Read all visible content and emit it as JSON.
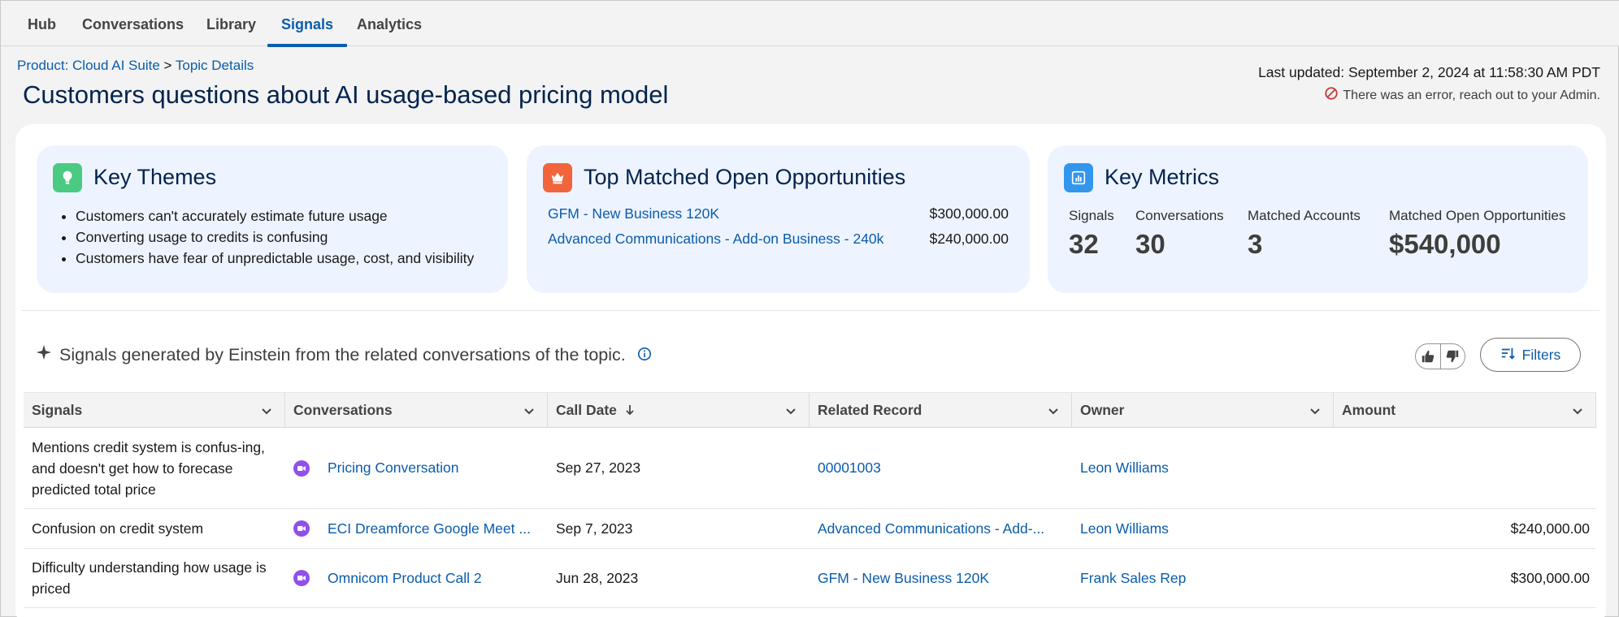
{
  "nav": {
    "tabs": [
      {
        "label": "Hub"
      },
      {
        "label": "Conversations"
      },
      {
        "label": "Library"
      },
      {
        "label": "Signals"
      },
      {
        "label": "Analytics"
      }
    ],
    "active": "Signals"
  },
  "breadcrumb": {
    "product_link": "Product: Cloud AI Suite",
    "separator": ">",
    "current_link": "Topic Details"
  },
  "page": {
    "title": "Customers questions about AI usage-based pricing model",
    "last_updated": "Last updated: September 2, 2024 at 11:58:30 AM PDT",
    "error": "There was an error, reach out to your Admin."
  },
  "colors": {
    "accent": "#0b5cab",
    "themes_icon": "#4bca81",
    "opps_icon": "#f2643b",
    "metrics_icon": "#3296ed",
    "error": "#c23934",
    "conversation_icon": "#9050e9"
  },
  "key_themes": {
    "title": "Key Themes",
    "icon": "lightbulb-icon",
    "items": [
      "Customers can't accurately estimate future usage",
      "Converting usage to credits is confusing",
      "Customers have fear of unpredictable usage, cost, and visibility"
    ]
  },
  "top_opps": {
    "title": "Top Matched Open Opportunities",
    "icon": "crown-icon",
    "items": [
      {
        "name": "GFM - New Business 120K",
        "amount": "$300,000.00"
      },
      {
        "name": "Advanced Communications - Add-on Business - 240k",
        "amount": "$240,000.00"
      }
    ]
  },
  "key_metrics": {
    "title": "Key Metrics",
    "icon": "chart-icon",
    "items": [
      {
        "label": "Signals",
        "value": "32"
      },
      {
        "label": "Conversations",
        "value": "30"
      },
      {
        "label": "Matched Accounts",
        "value": "3"
      },
      {
        "label": "Matched Open Opportunities",
        "value": "$540,000"
      }
    ]
  },
  "signals_section": {
    "heading": "Signals generated by Einstein from the related conversations of the topic.",
    "filters_label": "Filters"
  },
  "table": {
    "columns": [
      "Signals",
      "Conversations",
      "Call Date",
      "Related Record",
      "Owner",
      "Amount"
    ],
    "rows": [
      {
        "signal": "Mentions credit system is confus-ing, and doesn't get how to forecase predicted total price",
        "conversation": "Pricing Conversation",
        "call_date": "Sep 27, 2023",
        "related_record": "00001003",
        "owner": "Leon Williams",
        "amount": ""
      },
      {
        "signal": "Confusion on credit system",
        "conversation": "ECI Dreamforce Google Meet ...",
        "call_date": "Sep 7, 2023",
        "related_record": "Advanced Communications - Add-...",
        "owner": "Leon Williams",
        "amount": "$240,000.00"
      },
      {
        "signal": "Difficulty understanding how usage is priced",
        "conversation": "Omnicom Product Call 2",
        "call_date": "Jun 28, 2023",
        "related_record": "GFM - New Business 120K",
        "owner": "Frank Sales Rep",
        "amount": "$300,000.00"
      }
    ]
  }
}
